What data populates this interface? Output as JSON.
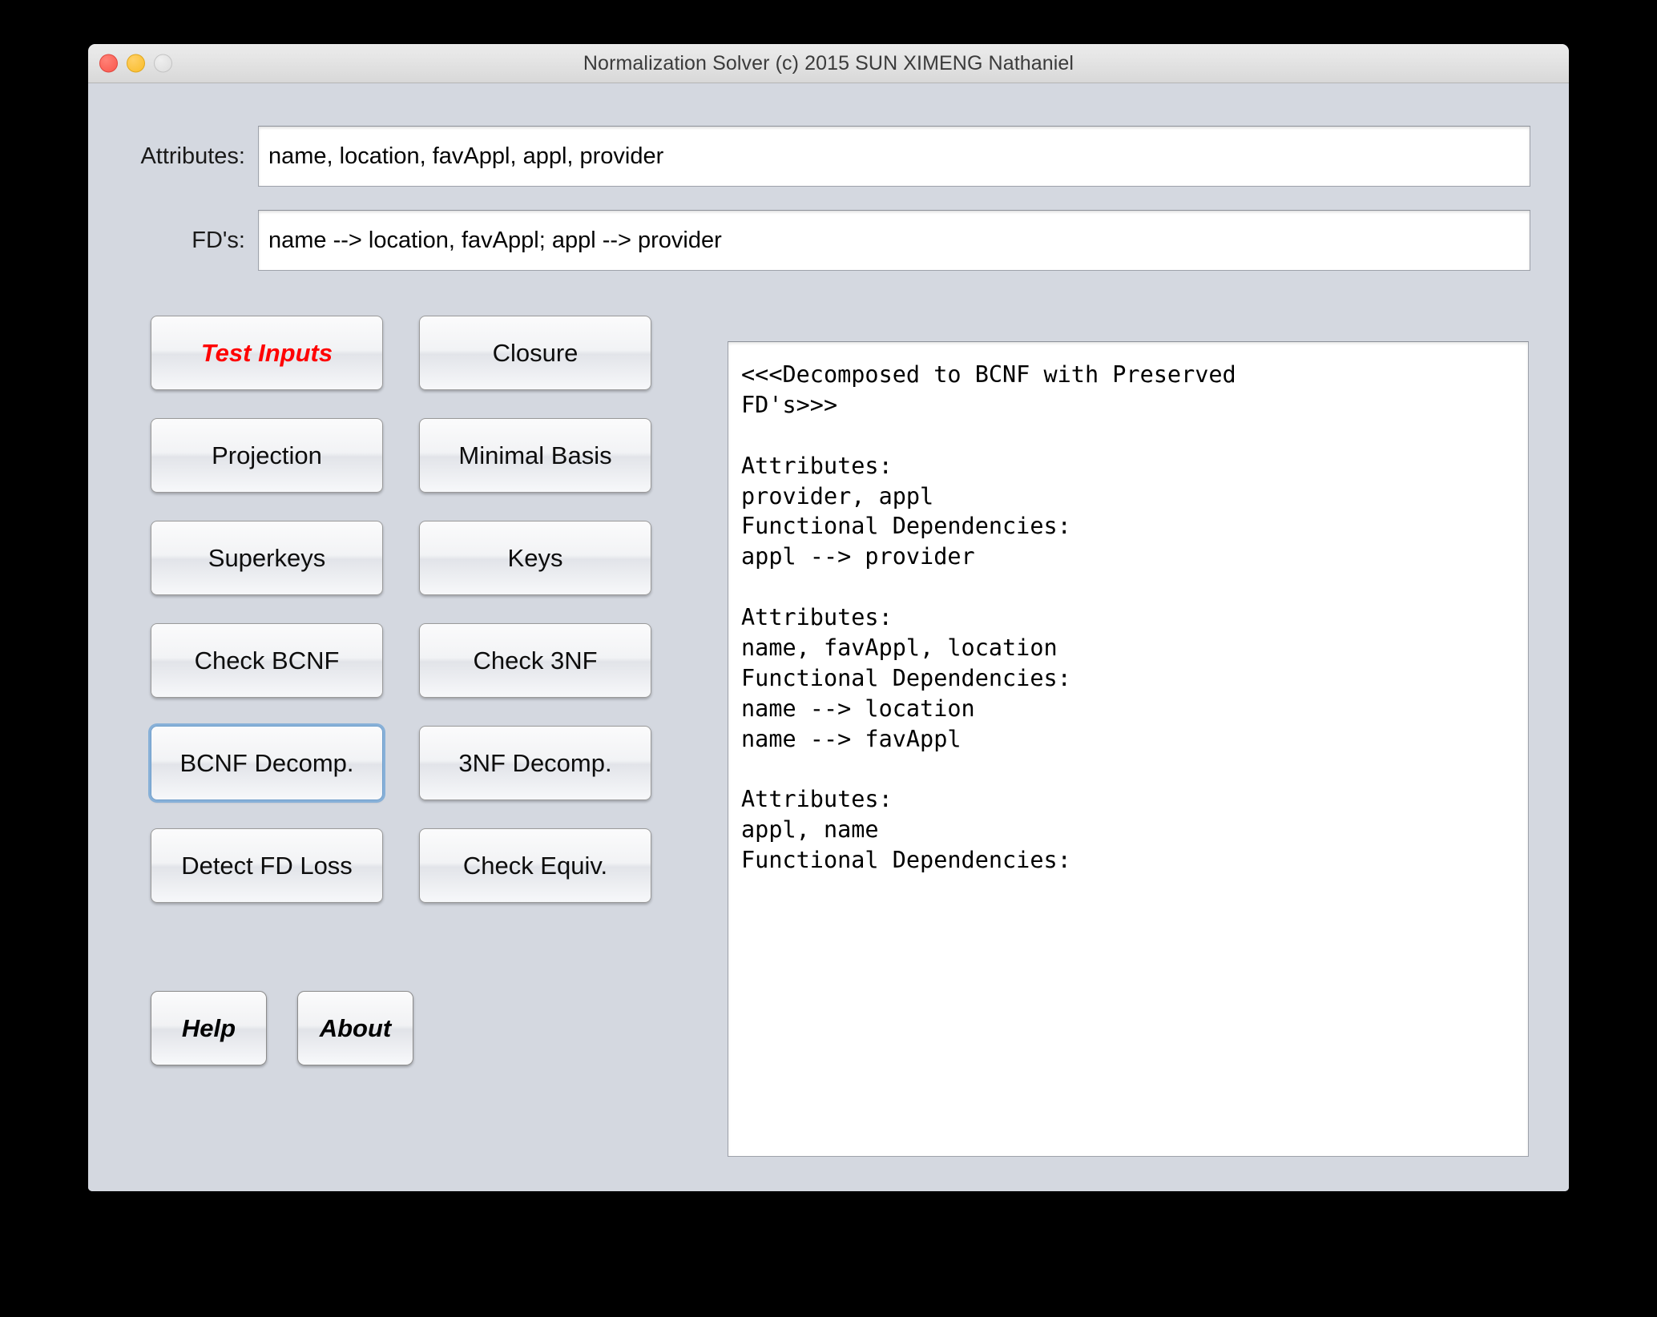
{
  "window": {
    "title": "Normalization Solver (c) 2015 SUN XIMENG Nathaniel",
    "traffic_lights": [
      {
        "name": "close",
        "color": "#f9564c"
      },
      {
        "name": "minimize",
        "color": "#f9bc29"
      },
      {
        "name": "zoom",
        "color": "#dcdcdc"
      }
    ]
  },
  "form": {
    "attributes": {
      "label": "Attributes:",
      "value": "name, location, favAppl, appl, provider",
      "placeholder": ""
    },
    "fds": {
      "label": "FD's:",
      "value": "name --> location, favAppl; appl --> provider",
      "placeholder": ""
    }
  },
  "buttons": {
    "accent_color": "#ff0000",
    "focus_color": "#87b0d8",
    "rows": [
      {
        "left": "Test Inputs",
        "right": "Closure"
      },
      {
        "left": "Projection",
        "right": "Minimal Basis"
      },
      {
        "left": "Superkeys",
        "right": "Keys"
      },
      {
        "left": "Check BCNF",
        "right": "Check 3NF"
      },
      {
        "left": "BCNF Decomp.",
        "right": "3NF Decomp."
      },
      {
        "left": "Detect FD Loss",
        "right": "Check Equiv."
      }
    ],
    "help": "Help",
    "about": "About"
  },
  "output": {
    "text": "<<<Decomposed to BCNF with Preserved\nFD's>>>\n\nAttributes:\nprovider, appl\nFunctional Dependencies:\nappl --> provider\n\nAttributes:\nname, favAppl, location\nFunctional Dependencies:\nname --> location\nname --> favAppl\n\nAttributes:\nappl, name\nFunctional Dependencies:\n"
  }
}
